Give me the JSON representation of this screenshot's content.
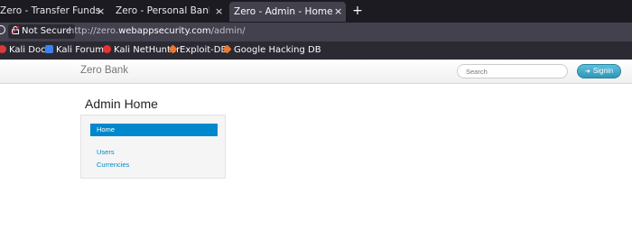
{
  "browser": {
    "tabs": [
      {
        "label": "Zero - Transfer Funds",
        "close": "×"
      },
      {
        "label": "Zero - Personal Banking - Lo",
        "close": "×"
      },
      {
        "label": "Zero - Admin - Home",
        "close": "×",
        "active": true
      }
    ],
    "new_tab": "+",
    "security_label": "Not Secure",
    "url_prefix": "http://zero.",
    "url_host": "webappsecurity.com",
    "url_path": "/admin/",
    "bookmarks": [
      "Kali Docs",
      "Kali Forums",
      "Kali NetHunter",
      "Exploit-DB",
      "Google Hacking DB"
    ]
  },
  "site": {
    "brand": "Zero Bank",
    "search_placeholder": "Search",
    "signin_label": "Signin",
    "accent_color": "#0088cc"
  },
  "admin": {
    "title": "Admin Home",
    "nav": {
      "home": "Home",
      "users": "Users",
      "currencies": "Currencies"
    }
  }
}
